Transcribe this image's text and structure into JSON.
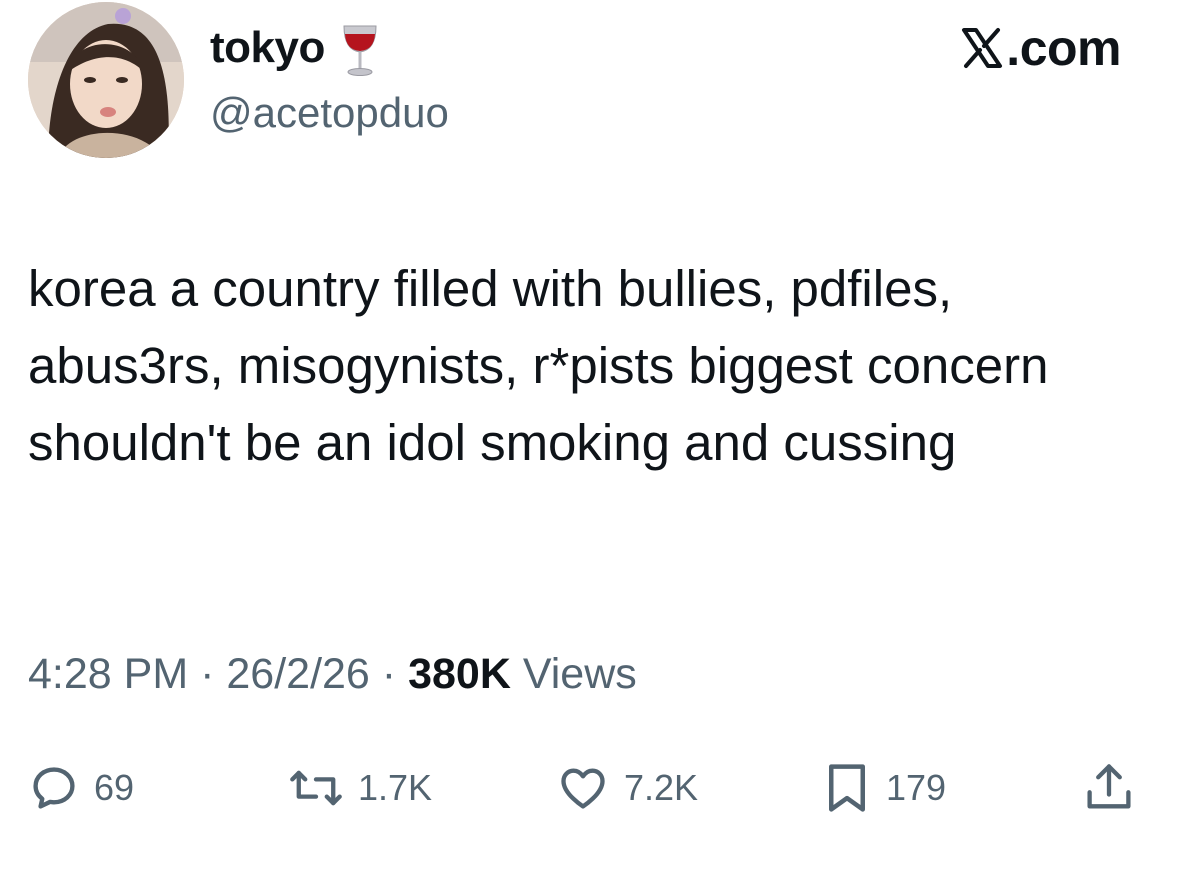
{
  "author": {
    "display_name": "tokyo",
    "name_emoji_icon": "wine-glass-icon",
    "handle": "@acetopduo",
    "avatar_icon": "profile-photo"
  },
  "source": {
    "logo_text": ".com",
    "logo_icon": "x-logo-icon"
  },
  "tweet": {
    "text": "korea a country filled with bullies, pdfiles, abus3rs, misogynists, r*pists biggest concern shouldn't be an idol smoking and cussing"
  },
  "meta": {
    "time": "4:28 PM",
    "separator": "·",
    "date": "26/2/26",
    "views_count": "380K",
    "views_label": "Views"
  },
  "actions": {
    "replies": "69",
    "reposts": "1.7K",
    "likes": "7.2K",
    "bookmarks": "179"
  },
  "colors": {
    "text_primary": "#0f1419",
    "text_secondary": "#536471",
    "background": "#ffffff"
  }
}
